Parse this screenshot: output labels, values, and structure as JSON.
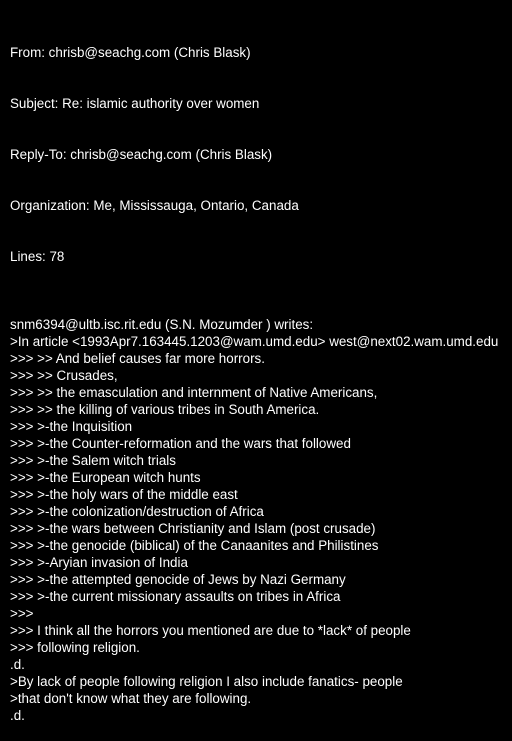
{
  "headers": {
    "from": "From: chrisb@seachg.com (Chris Blask)",
    "subject": "Subject: Re: islamic authority over women",
    "reply_to": "Reply-To: chrisb@seachg.com (Chris Blask)",
    "organization": "Organization: Me, Mississauga, Ontario, Canada",
    "lines": "Lines: 78"
  },
  "body": [
    "",
    "snm6394@ultb.isc.rit.edu (S.N. Mozumder ) writes:",
    ">In article <1993Apr7.163445.1203@wam.umd.edu> west@next02.wam.umd.edu",
    ">>> >> And belief causes far more horrors.",
    ">>> >> Crusades,",
    ">>> >> the emasculation and internment of Native Americans,",
    ">>> >> the killing of various tribes in South America.",
    ">>> >-the Inquisition",
    ">>> >-the Counter-reformation and the wars that followed",
    ">>> >-the Salem witch trials",
    ">>> >-the European witch hunts",
    ">>> >-the holy wars of the middle east",
    ">>> >-the colonization/destruction of Africa",
    ">>> >-the wars between Christianity and Islam (post crusade)",
    ">>> >-the genocide (biblical) of the Canaanites and Philistines",
    ">>> >-Aryian invasion of India",
    ">>> >-the attempted genocide of Jews by Nazi Germany",
    ">>> >-the current missionary assaults on tribes in Africa",
    ">>>",
    ">>> I think all the horrors you mentioned are due to *lack* of people",
    ">>> following religion.",
    ".d.",
    ">By lack of people following religion I also include fanatics- people",
    ">that don't know what they are following.",
    ".d."
  ],
  "colors": {
    "background": "#000000",
    "text": "#ffffff"
  }
}
